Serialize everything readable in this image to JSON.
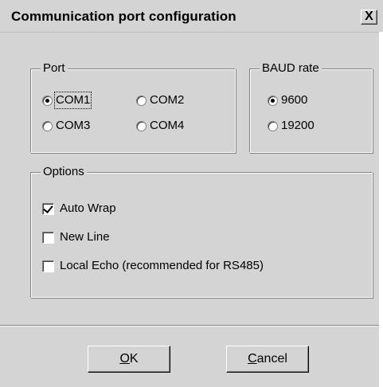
{
  "window": {
    "title": "Communication port configuration",
    "close_label": "X"
  },
  "port_group": {
    "label": "Port",
    "options": [
      {
        "label": "COM1",
        "selected": true
      },
      {
        "label": "COM2",
        "selected": false
      },
      {
        "label": "COM3",
        "selected": false
      },
      {
        "label": "COM4",
        "selected": false
      }
    ]
  },
  "baud_group": {
    "label": "BAUD rate",
    "options": [
      {
        "label": "9600",
        "selected": true
      },
      {
        "label": "19200",
        "selected": false
      }
    ]
  },
  "options_group": {
    "label": "Options",
    "items": [
      {
        "label": "Auto Wrap",
        "checked": true
      },
      {
        "label": "New Line",
        "checked": false
      },
      {
        "label": "Local Echo (recommended for RS485)",
        "checked": false
      }
    ]
  },
  "buttons": {
    "ok_label": "OK",
    "cancel_label": "Cancel"
  }
}
